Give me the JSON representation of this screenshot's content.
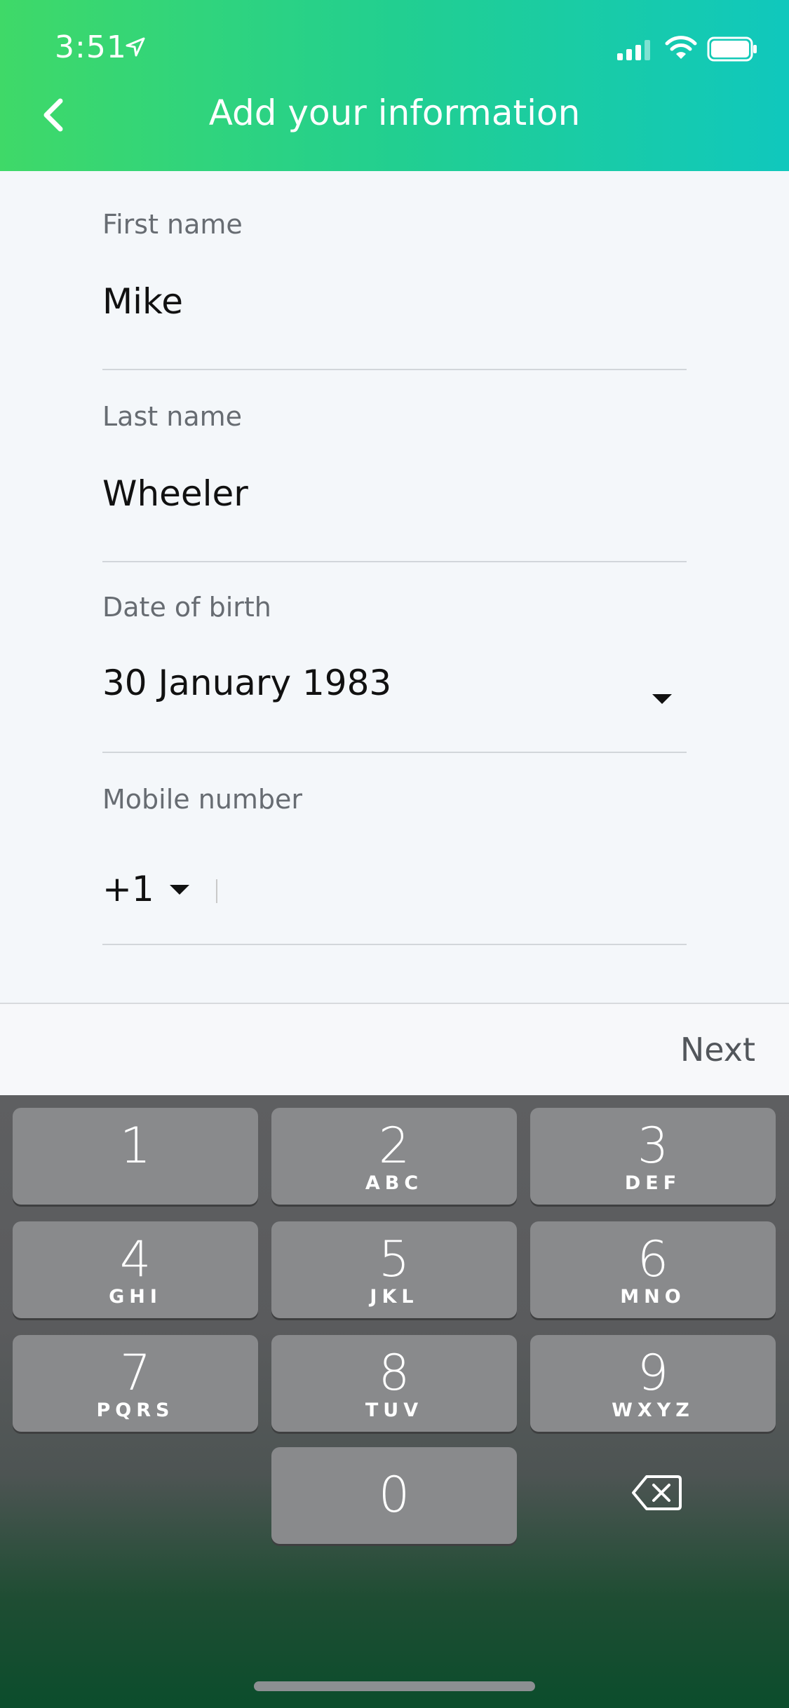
{
  "status_bar": {
    "time": "3:51"
  },
  "header": {
    "title": "Add your information"
  },
  "form": {
    "first_name": {
      "label": "First name",
      "value": "Mike"
    },
    "last_name": {
      "label": "Last name",
      "value": "Wheeler"
    },
    "date_of_birth": {
      "label": "Date of birth",
      "value": "30 January 1983"
    },
    "mobile_number": {
      "label": "Mobile number",
      "country_code": "+1",
      "value": ""
    }
  },
  "toolbar": {
    "next_label": "Next"
  },
  "keypad": {
    "keys": [
      {
        "digit": "1",
        "letters": ""
      },
      {
        "digit": "2",
        "letters": "ABC"
      },
      {
        "digit": "3",
        "letters": "DEF"
      },
      {
        "digit": "4",
        "letters": "GHI"
      },
      {
        "digit": "5",
        "letters": "JKL"
      },
      {
        "digit": "6",
        "letters": "MNO"
      },
      {
        "digit": "7",
        "letters": "PQRS"
      },
      {
        "digit": "8",
        "letters": "TUV"
      },
      {
        "digit": "9",
        "letters": "WXYZ"
      },
      {
        "digit": "0",
        "letters": ""
      }
    ]
  },
  "colors": {
    "header_gradient_start": "#3fd968",
    "header_gradient_end": "#10c8bd",
    "keyboard_key": "#898a8c"
  }
}
